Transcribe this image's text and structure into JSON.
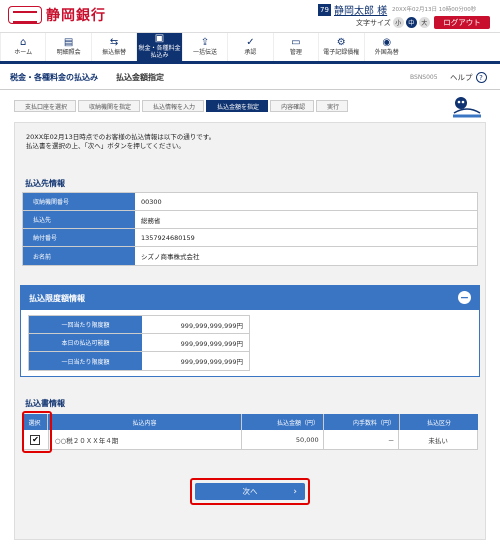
{
  "header": {
    "bank_name": "静岡銀行",
    "user_badge": "79",
    "user_name": "静岡太郎 様",
    "last_login": "20XX年02月13日 10時00分00秒",
    "font_size_label": "文字サイズ",
    "font_sizes": [
      "小",
      "中",
      "大"
    ],
    "logout": "ログアウト"
  },
  "nav": [
    {
      "label": "ホーム",
      "icon": "home-icon"
    },
    {
      "label": "明細照会",
      "icon": "document-icon"
    },
    {
      "label": "振込振替",
      "icon": "transfer-icon"
    },
    {
      "label": "税金・各種料金\n払込み",
      "icon": "tax-icon"
    },
    {
      "label": "一括伝送",
      "icon": "upload-icon"
    },
    {
      "label": "承認",
      "icon": "check-icon"
    },
    {
      "label": "管理",
      "icon": "folder-icon"
    },
    {
      "label": "電子記録債権",
      "icon": "settings-icon"
    },
    {
      "label": "外国為替",
      "icon": "globe-icon"
    }
  ],
  "titlebar": {
    "section": "税金・各種料金の払込み",
    "screen": "払込金額指定",
    "code": "BSNS005",
    "help": "ヘルプ"
  },
  "steps": [
    "支払口座を選択",
    "収納機関を指定",
    "払込情報を入力",
    "払込金額を指定",
    "内容確認",
    "実行"
  ],
  "intro": {
    "line1": "20XX年02月13日時点でのお客様の払込情報は以下の通りです。",
    "line2": "払込書を選択の上、「次へ」ボタンを押してください。"
  },
  "payee": {
    "heading": "払込先情報",
    "rows": [
      {
        "k": "収納機関番号",
        "v": "00300"
      },
      {
        "k": "払込先",
        "v": "総務省"
      },
      {
        "k": "納付番号",
        "v": "1357924680159"
      },
      {
        "k": "お名前",
        "v": "シズノ商事株式会社"
      }
    ]
  },
  "limits": {
    "heading": "払込限度額情報",
    "rows": [
      {
        "k": "一回当たり限度額",
        "v": "999,999,999,999円"
      },
      {
        "k": "本日の払込可能額",
        "v": "999,999,999,999円"
      },
      {
        "k": "一日当たり限度額",
        "v": "999,999,999,999円"
      }
    ]
  },
  "bill": {
    "heading": "払込書情報",
    "columns": [
      "選択",
      "払込内容",
      "払込金額（円）",
      "内手数料（円）",
      "払込区分"
    ],
    "row": {
      "content": "○○税２０ＸＸ年４期",
      "amount": "50,000",
      "fee": "－",
      "status": "未払い"
    }
  },
  "next_button": "次へ"
}
